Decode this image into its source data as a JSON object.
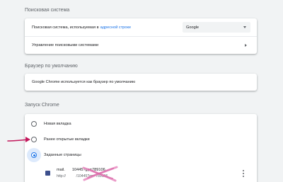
{
  "search_engine": {
    "section_title": "Поисковая система",
    "row_label": "Поисковая система, используемая в",
    "row_link": "адресной строке",
    "selected_engine": "Google",
    "manage_label": "Управление поисковыми системами"
  },
  "default_browser": {
    "section_title": "Браузер по умолчанию",
    "status_text": "Google Chrome используется как браузер по умолчанию"
  },
  "startup": {
    "section_title": "Запуск Chrome",
    "options": [
      {
        "label": "Новая вкладка",
        "checked": false
      },
      {
        "label": "Ранее открытые вкладки",
        "checked": false
      },
      {
        "label": "Заданные страницы",
        "checked": true
      }
    ],
    "pages": [
      {
        "title": "mail.         10445?gp=789106",
        "url": "http://              /10445?gp=789106"
      }
    ]
  },
  "colors": {
    "accent": "#1a73e8",
    "annotation": "#c2185b"
  },
  "icons": {
    "dropdown": "chevron-down-icon",
    "submenu": "chevron-right-icon",
    "more": "more-vert-icon",
    "favicon": "site-favicon-icon"
  }
}
